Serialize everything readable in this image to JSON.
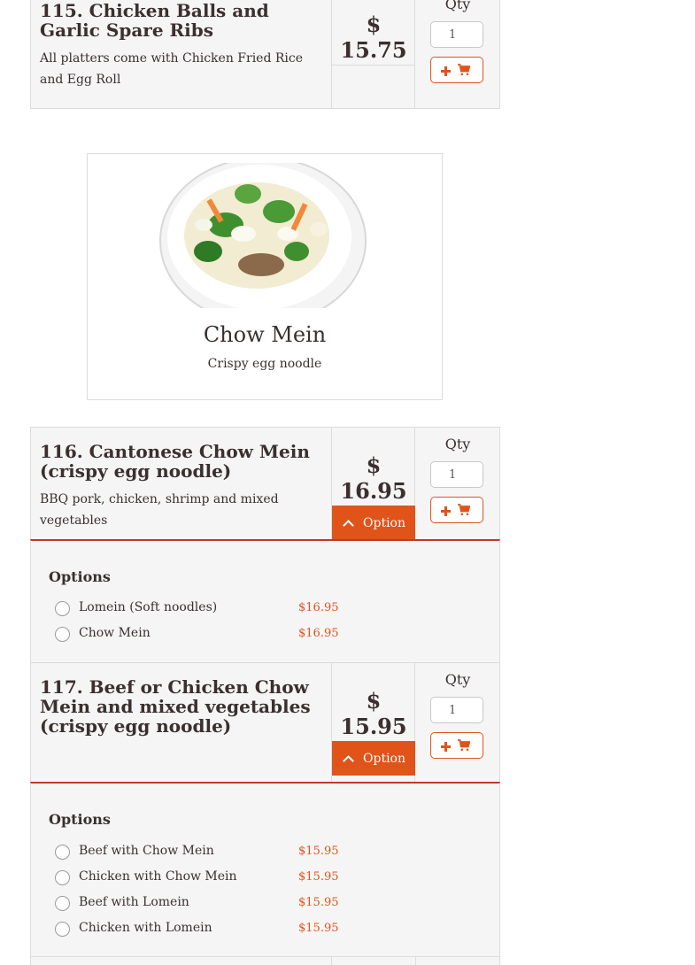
{
  "items": [
    {
      "title": "115. Chicken Balls and Garlic Spare Ribs",
      "description": "All platters come with Chicken Fried Rice and Egg Roll",
      "price": "$ 15.75",
      "qty_label": "Qty",
      "qty_value": "1"
    },
    {
      "title": "116. Cantonese Chow Mein (crispy egg noodle)",
      "description": "BBQ pork, chicken, shrimp and mixed vegetables",
      "price": "$ 16.95",
      "option_label": "Option",
      "qty_label": "Qty",
      "qty_value": "1",
      "options_title": "Options",
      "options": [
        {
          "name": "Lomein (Soft noodles)",
          "price": "$16.95"
        },
        {
          "name": "Chow Mein",
          "price": "$16.95"
        }
      ]
    },
    {
      "title": "117. Beef or Chicken Chow Mein and mixed vegetables (crispy egg noodle)",
      "price": "$ 15.95",
      "option_label": "Option",
      "qty_label": "Qty",
      "qty_value": "1",
      "options_title": "Options",
      "options": [
        {
          "name": "Beef with Chow Mein",
          "price": "$15.95"
        },
        {
          "name": "Chicken with Chow Mein",
          "price": "$15.95"
        },
        {
          "name": "Beef with Lomein",
          "price": "$15.95"
        },
        {
          "name": "Chicken with Lomein",
          "price": "$15.95"
        }
      ]
    }
  ],
  "category": {
    "title": "Chow Mein",
    "subtitle": "Crispy egg noodle",
    "image_icon": "chow-mein-photo"
  },
  "icons": {
    "add": "plus-icon",
    "cart": "cart-icon",
    "collapse": "chevron-up-icon"
  },
  "colors": {
    "accent": "#e0541a",
    "divider": "#c0392b",
    "card_bg": "#f5f5f5",
    "text": "#3b2f2f"
  }
}
